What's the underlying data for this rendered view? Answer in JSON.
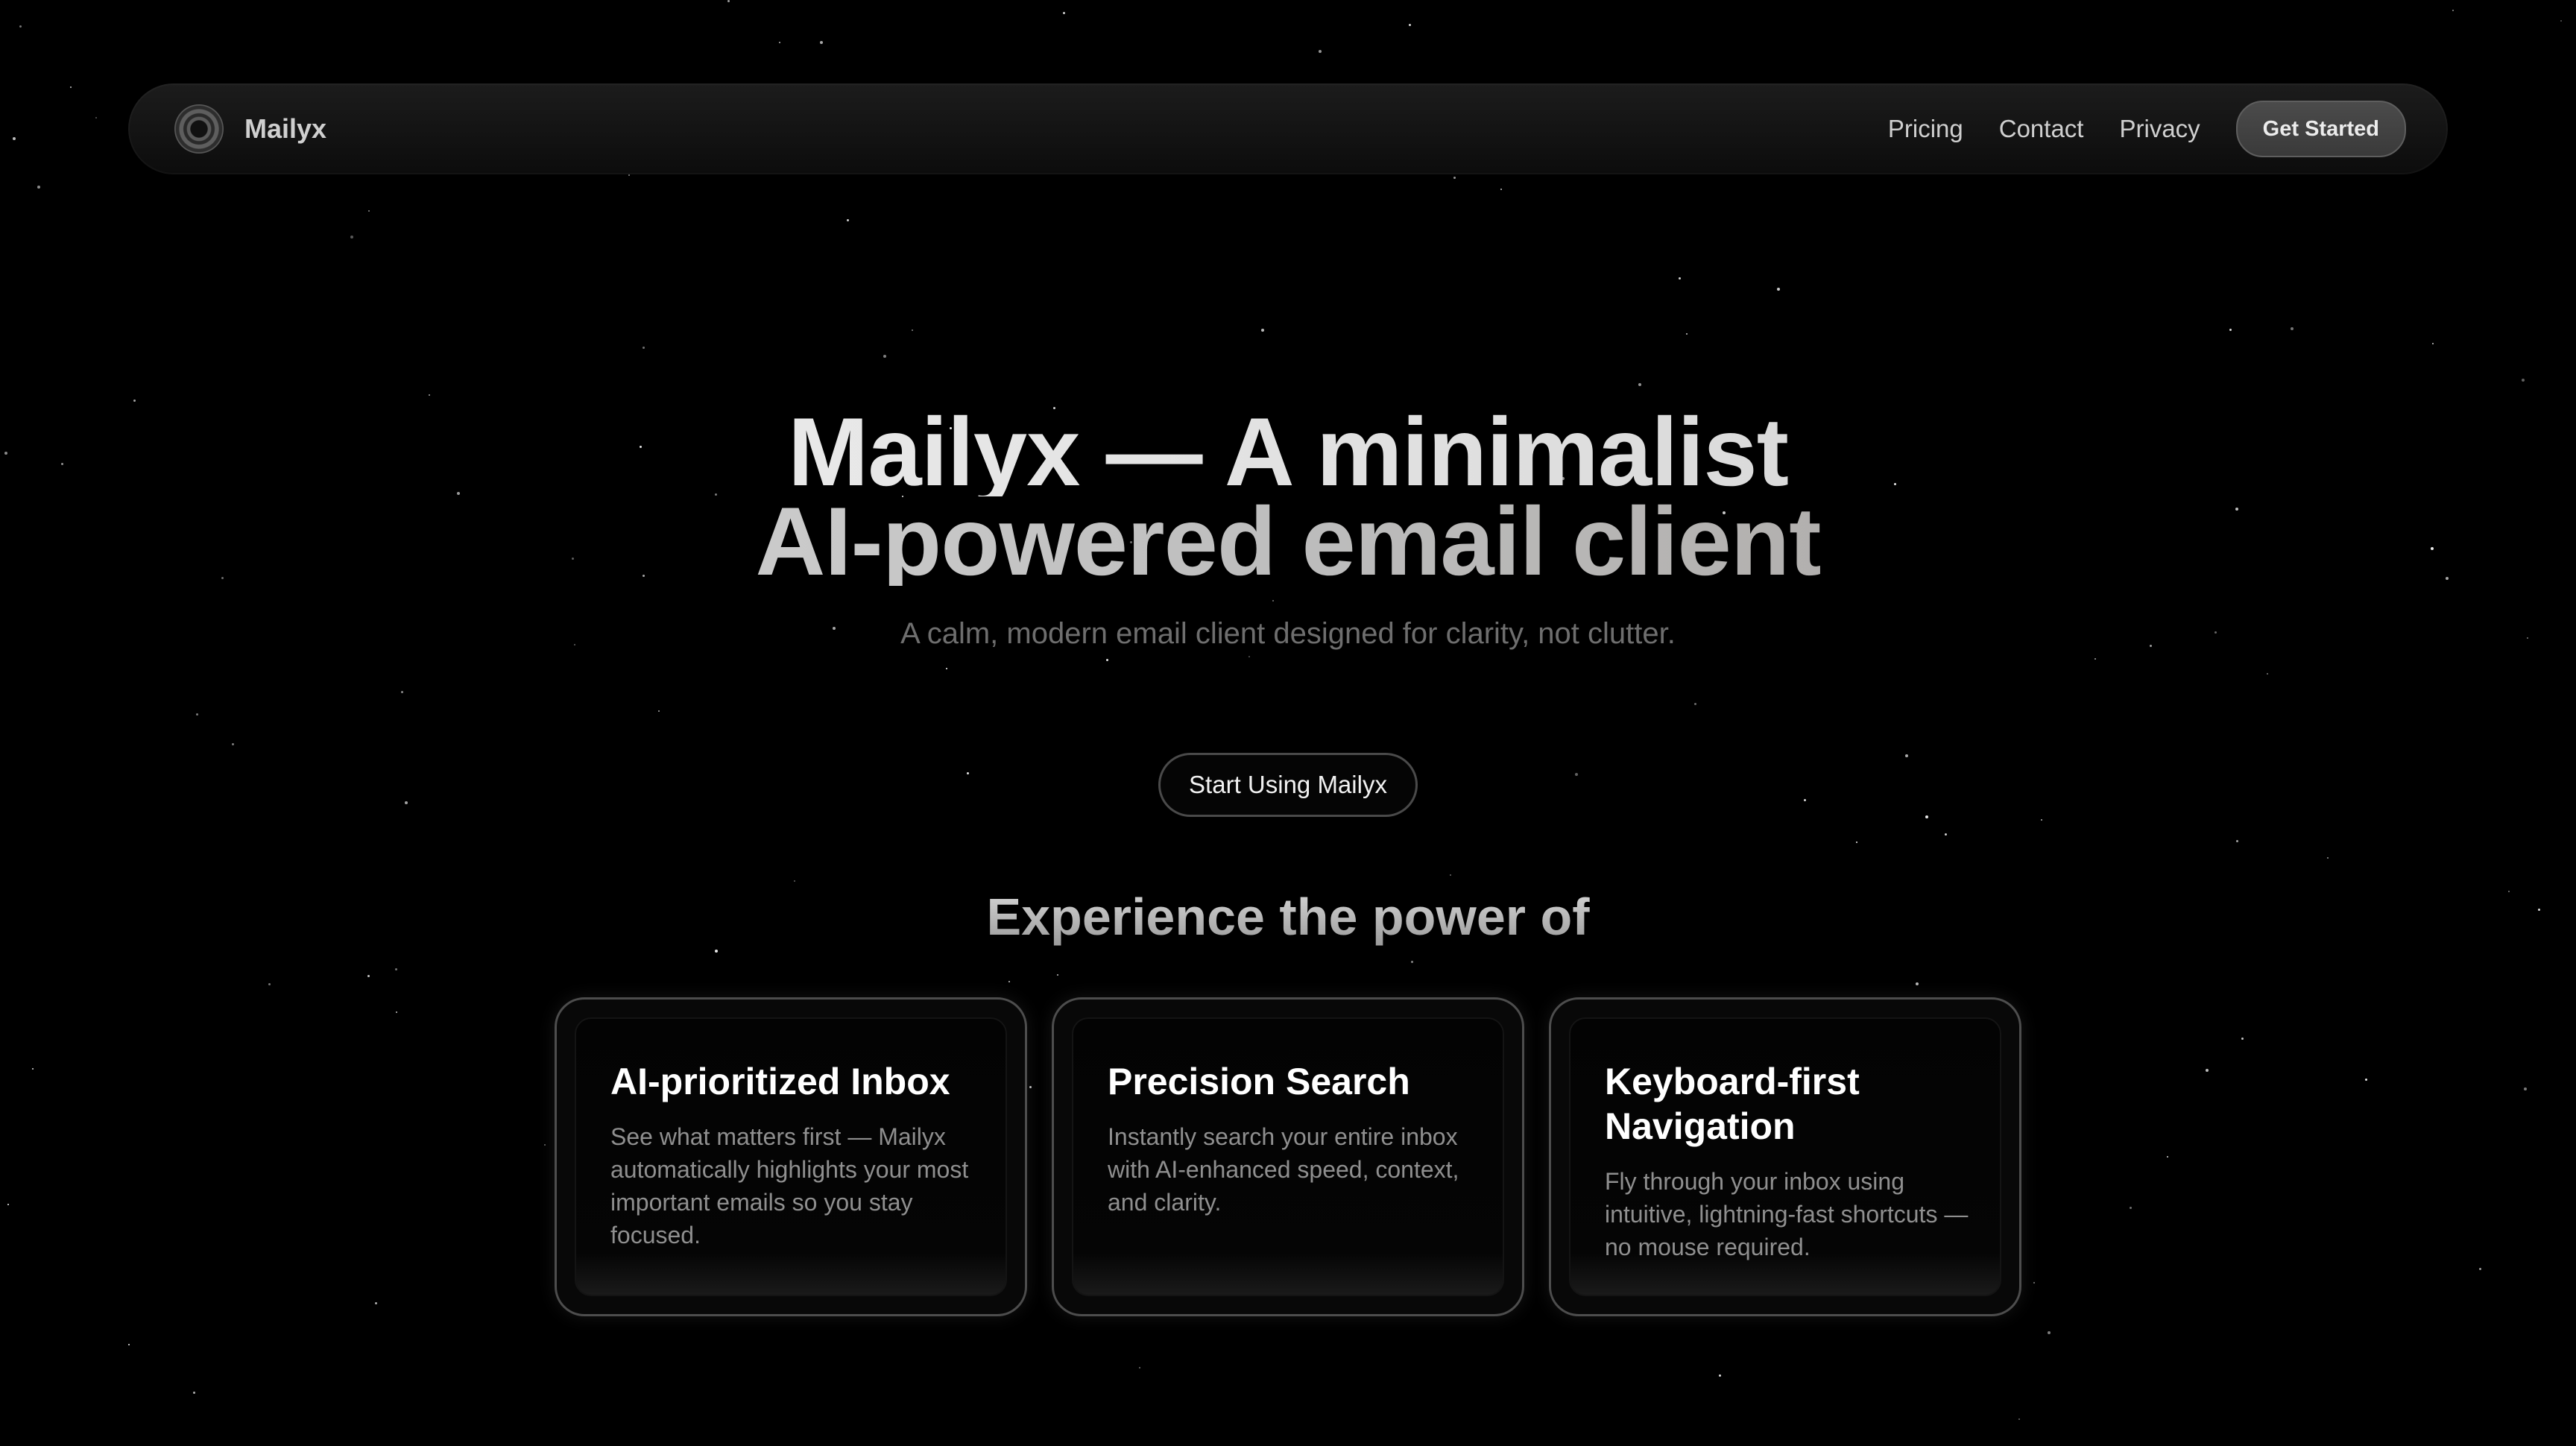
{
  "navbar": {
    "logo_icon": "circle-logo-icon",
    "brand": "Mailyx",
    "links": [
      "Pricing",
      "Contact",
      "Privacy"
    ],
    "cta": "Get Started"
  },
  "hero": {
    "title_line1": "Mailyx — A minimalist",
    "title_line2": "AI-powered email client",
    "subtitle": "A calm, modern email client designed for clarity, not clutter.",
    "cta": "Start Using Mailyx"
  },
  "features": {
    "heading": "Experience the power of",
    "cards": [
      {
        "title": "AI-prioritized Inbox",
        "description": "See what matters first — Mailyx automatically highlights your most important emails so you stay focused."
      },
      {
        "title": "Precision Search",
        "description": "Instantly search your entire inbox with AI-enhanced speed, context, and clarity."
      },
      {
        "title": "Keyboard-first Navigation",
        "description": "Fly through your inbox using intuitive, lightning-fast shortcuts — no mouse required."
      }
    ]
  },
  "colors": {
    "background": "#000000",
    "navbar": "#141414",
    "button": "#444444",
    "muted_text": "#6e6e6e"
  }
}
